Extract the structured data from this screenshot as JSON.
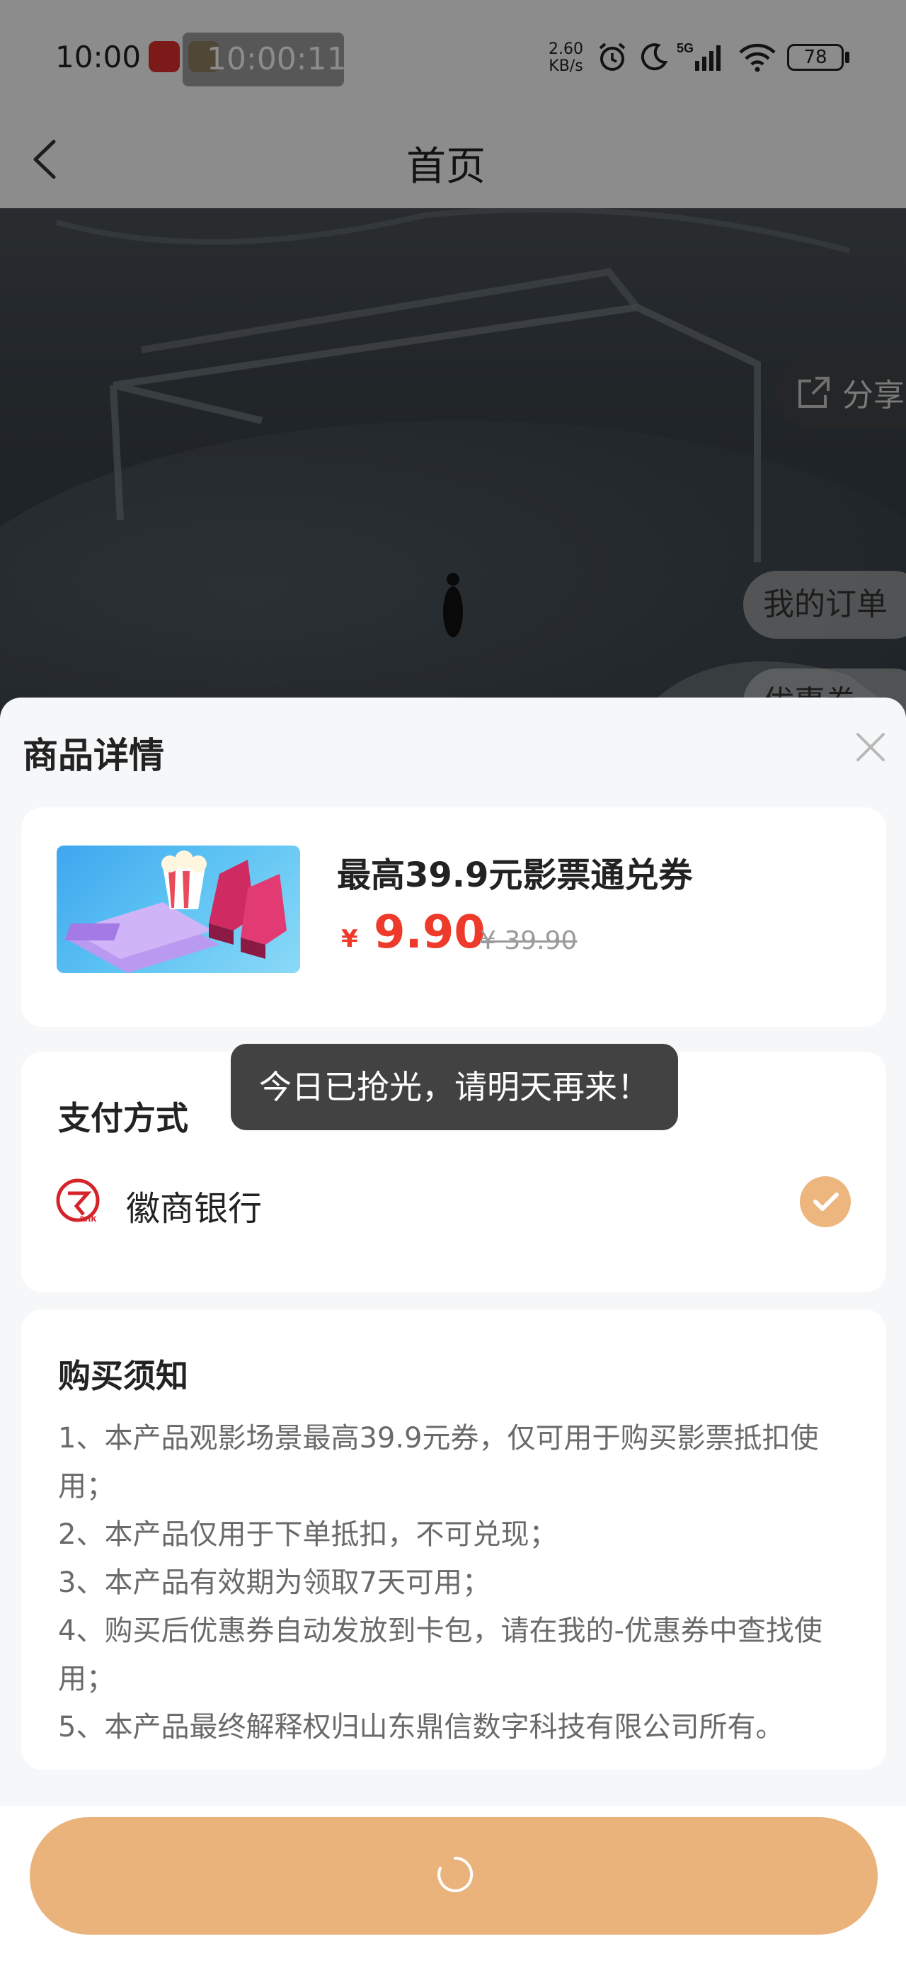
{
  "status_bar": {
    "time": "10:00",
    "overlay_time": "10:00:11",
    "net_speed_value": "2.60",
    "net_speed_unit": "KB/s",
    "network": "5G",
    "battery": "78"
  },
  "nav": {
    "title": "首页",
    "back_icon": "chevron-left-icon"
  },
  "hero": {
    "share_label": "分享",
    "my_orders_label": "我的订单",
    "coupons_label": "优惠券"
  },
  "sheet": {
    "title": "商品详情",
    "product": {
      "title": "最高39.9元影票通兑券",
      "currency": "¥",
      "price": "9.90",
      "original_price": "¥ 39.90"
    },
    "payment": {
      "title": "支付方式",
      "bank_name": "徽商银行",
      "selected": true
    },
    "notice": {
      "title": "购买须知",
      "lines": [
        "1、本产品观影场景最高39.9元券，仅可用于购买影票抵扣使用；",
        "2、本产品仅用于下单抵扣，不可兑现；",
        "3、本产品有效期为领取7天可用；",
        "4、购买后优惠券自动发放到卡包，请在我的-优惠券中查找使用；",
        "5、本产品最终解释权归山东鼎信数字科技有限公司所有。"
      ]
    }
  },
  "toast": "今日已抢光，请明天再来！",
  "colors": {
    "price_red": "#ee3a2a",
    "button_orange": "#e9b37b",
    "check_orange": "#ecb67e"
  }
}
